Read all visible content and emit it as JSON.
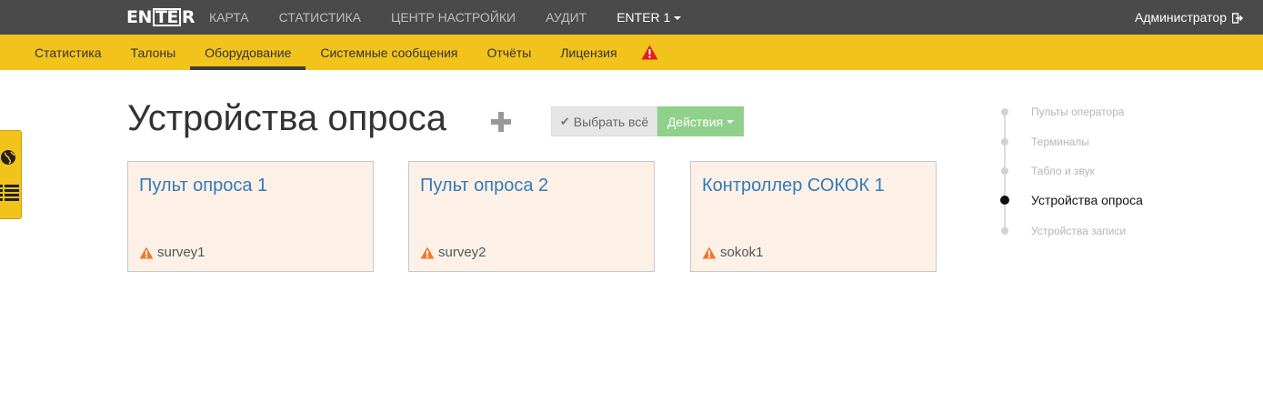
{
  "topbar": {
    "logo_pre": "EN",
    "logo_box": "TE",
    "logo_post": "R",
    "nav": [
      {
        "label": "КАРТА"
      },
      {
        "label": "СТАТИСТИКА"
      },
      {
        "label": "ЦЕНТР НАСТРОЙКИ"
      },
      {
        "label": "АУДИТ"
      },
      {
        "label": "ENTER 1"
      }
    ],
    "user": "Администратор"
  },
  "subnav": [
    {
      "label": "Статистика"
    },
    {
      "label": "Талоны"
    },
    {
      "label": "Оборудование"
    },
    {
      "label": "Системные сообщения"
    },
    {
      "label": "Отчёты"
    },
    {
      "label": "Лицензия"
    }
  ],
  "page": {
    "title": "Устройства опроса",
    "select_all": "Выбрать всё",
    "actions": "Действия"
  },
  "cards": [
    {
      "name": "Пульт опроса 1",
      "code": "survey1"
    },
    {
      "name": "Пульт опроса 2",
      "code": "survey2"
    },
    {
      "name": "Контроллер СОКОК 1",
      "code": "sokok1"
    }
  ],
  "timeline": [
    {
      "label": "Пульты оператора"
    },
    {
      "label": "Терминалы"
    },
    {
      "label": "Табло и звук"
    },
    {
      "label": "Устройства опроса"
    },
    {
      "label": "Устройства записи"
    }
  ],
  "colors": {
    "topbar": "#4a4a4a",
    "accent_yellow": "#f2c31b",
    "card_bg": "#fdf1e7",
    "link_blue": "#337ab7",
    "actions_green": "#8fd08b",
    "warning_orange": "#f0782e",
    "alert_red": "#e02020"
  },
  "icons": {
    "logout": "logout-icon",
    "alert": "warning-triangle-icon",
    "globe": "globe-icon",
    "list": "list-icon",
    "plus": "plus-icon",
    "check": "check-icon",
    "card_warning": "warning-icon"
  }
}
